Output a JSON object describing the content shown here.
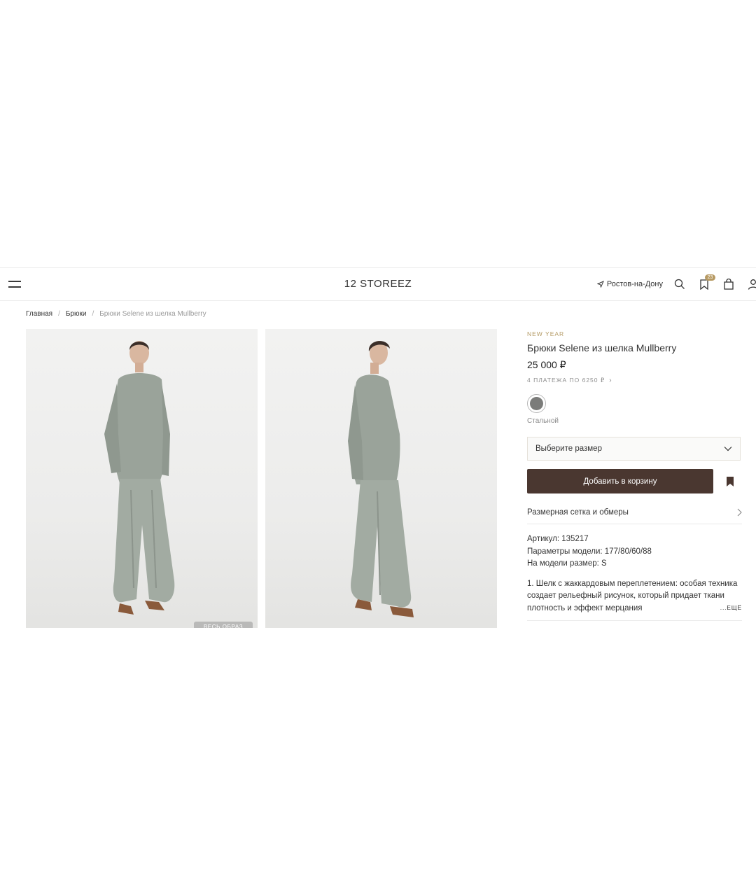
{
  "header": {
    "logo": "12 STOREEZ",
    "city": "Ростов-на-Дону",
    "wishlist_count": "23"
  },
  "breadcrumb": [
    "Главная",
    "Брюки",
    "Брюки Selene из шелка Mullberry"
  ],
  "gallery": {
    "look_button": "ВЕСЬ ОБРАЗ"
  },
  "product": {
    "collection": "NEW YEAR",
    "title": "Брюки Selene из шелка Mullberry",
    "price": "25 000 ₽",
    "installments": "4 ПЛАТЕЖА ПО 6250 ₽",
    "color": {
      "name": "Стальной",
      "hex": "#7b7c7a"
    },
    "size_placeholder": "Выберите размер",
    "add_to_cart": "Добавить в корзину",
    "size_guide": "Размерная сетка и обмеры",
    "article": "Артикул: 135217",
    "model_params": "Параметры модели: 177/80/60/88",
    "model_size": "На модели размер: S",
    "description": "1. Шелк с жаккардовым переплетением: особая техника создает рельефный рисунок, который придает ткани плотность и эффект мерцания",
    "more": "...ЕЩЁ"
  },
  "colors": {
    "accent": "#b49a64",
    "button": "#4a3730",
    "bookmark": "#4a3730"
  },
  "icons": {
    "menu": "menu-icon",
    "location": "location-arrow-icon",
    "search": "search-icon",
    "wishlist": "bookmark-icon",
    "cart": "shopping-bag-icon",
    "account": "user-icon"
  }
}
